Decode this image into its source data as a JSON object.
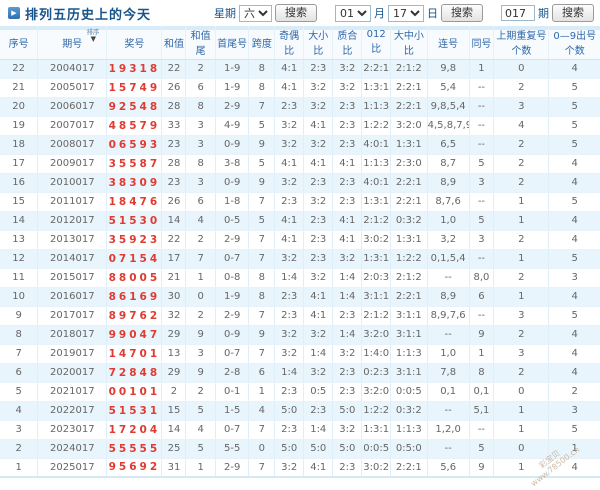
{
  "title": "排列五历史上的今天",
  "toolbar": {
    "week_label": "星期",
    "week_value": "六",
    "search_label": "搜索",
    "month_value": "01",
    "month_label": "月",
    "day_value": "17",
    "day_label": "日",
    "issue_value": "017",
    "issue_label": "期"
  },
  "table": {
    "sort_label": "排序",
    "sort_arrow": "▼",
    "columns": [
      "序号",
      "期号",
      "奖号",
      "和值",
      "和值尾",
      "首尾号",
      "跨度",
      "奇偶比",
      "大小比",
      "质合比",
      "012比",
      "大中小比",
      "连号",
      "同号",
      "上期重复号个数",
      "0—9出号个数"
    ],
    "rows": [
      [
        "22",
        "2004017",
        "19318",
        "22",
        "2",
        "1-9",
        "8",
        "4:1",
        "2:3",
        "3:2",
        "2:2:1",
        "2:1:2",
        "9,8",
        "1",
        "0",
        "4"
      ],
      [
        "21",
        "2005017",
        "15749",
        "26",
        "6",
        "1-9",
        "8",
        "4:1",
        "3:2",
        "3:2",
        "1:3:1",
        "2:2:1",
        "5,4",
        "--",
        "2",
        "5"
      ],
      [
        "20",
        "2006017",
        "92548",
        "28",
        "8",
        "2-9",
        "7",
        "2:3",
        "3:2",
        "2:3",
        "1:1:3",
        "2:2:1",
        "9,8,5,4",
        "--",
        "3",
        "5"
      ],
      [
        "19",
        "2007017",
        "48579",
        "33",
        "3",
        "4-9",
        "5",
        "3:2",
        "4:1",
        "2:3",
        "1:2:2",
        "3:2:0",
        "4,5,8,7,9",
        "--",
        "4",
        "5"
      ],
      [
        "18",
        "2008017",
        "06593",
        "23",
        "3",
        "0-9",
        "9",
        "3:2",
        "3:2",
        "2:3",
        "4:0:1",
        "1:3:1",
        "6,5",
        "--",
        "2",
        "5"
      ],
      [
        "17",
        "2009017",
        "35587",
        "28",
        "8",
        "3-8",
        "5",
        "4:1",
        "4:1",
        "4:1",
        "1:1:3",
        "2:3:0",
        "8,7",
        "5",
        "2",
        "4"
      ],
      [
        "16",
        "2010017",
        "38309",
        "23",
        "3",
        "0-9",
        "9",
        "3:2",
        "2:3",
        "2:3",
        "4:0:1",
        "2:2:1",
        "8,9",
        "3",
        "2",
        "4"
      ],
      [
        "15",
        "2011017",
        "18476",
        "26",
        "6",
        "1-8",
        "7",
        "2:3",
        "3:2",
        "2:3",
        "1:3:1",
        "2:2:1",
        "8,7,6",
        "--",
        "1",
        "5"
      ],
      [
        "14",
        "2012017",
        "51530",
        "14",
        "4",
        "0-5",
        "5",
        "4:1",
        "2:3",
        "4:1",
        "2:1:2",
        "0:3:2",
        "1,0",
        "5",
        "1",
        "4"
      ],
      [
        "13",
        "2013017",
        "35923",
        "22",
        "2",
        "2-9",
        "7",
        "4:1",
        "2:3",
        "4:1",
        "3:0:2",
        "1:3:1",
        "3,2",
        "3",
        "2",
        "4"
      ],
      [
        "12",
        "2014017",
        "07154",
        "17",
        "7",
        "0-7",
        "7",
        "3:2",
        "2:3",
        "3:2",
        "1:3:1",
        "1:2:2",
        "0,1,5,4",
        "--",
        "1",
        "5"
      ],
      [
        "11",
        "2015017",
        "88005",
        "21",
        "1",
        "0-8",
        "8",
        "1:4",
        "3:2",
        "1:4",
        "2:0:3",
        "2:1:2",
        "--",
        "8,0",
        "2",
        "3"
      ],
      [
        "10",
        "2016017",
        "86169",
        "30",
        "0",
        "1-9",
        "8",
        "2:3",
        "4:1",
        "1:4",
        "3:1:1",
        "2:2:1",
        "8,9",
        "6",
        "1",
        "4"
      ],
      [
        "9",
        "2017017",
        "89762",
        "32",
        "2",
        "2-9",
        "7",
        "2:3",
        "4:1",
        "2:3",
        "2:1:2",
        "3:1:1",
        "8,9,7,6",
        "--",
        "3",
        "5"
      ],
      [
        "8",
        "2018017",
        "99047",
        "29",
        "9",
        "0-9",
        "9",
        "3:2",
        "3:2",
        "1:4",
        "3:2:0",
        "3:1:1",
        "--",
        "9",
        "2",
        "4"
      ],
      [
        "7",
        "2019017",
        "14701",
        "13",
        "3",
        "0-7",
        "7",
        "3:2",
        "1:4",
        "3:2",
        "1:4:0",
        "1:1:3",
        "1,0",
        "1",
        "3",
        "4"
      ],
      [
        "6",
        "2020017",
        "72848",
        "29",
        "9",
        "2-8",
        "6",
        "1:4",
        "3:2",
        "2:3",
        "0:2:3",
        "3:1:1",
        "7,8",
        "8",
        "2",
        "4"
      ],
      [
        "5",
        "2021017",
        "00101",
        "2",
        "2",
        "0-1",
        "1",
        "2:3",
        "0:5",
        "2:3",
        "3:2:0",
        "0:0:5",
        "0,1",
        "0,1",
        "0",
        "2"
      ],
      [
        "4",
        "2022017",
        "51531",
        "15",
        "5",
        "1-5",
        "4",
        "5:0",
        "2:3",
        "5:0",
        "1:2:2",
        "0:3:2",
        "--",
        "5,1",
        "1",
        "3"
      ],
      [
        "3",
        "2023017",
        "17204",
        "14",
        "4",
        "0-7",
        "7",
        "2:3",
        "1:4",
        "3:2",
        "1:3:1",
        "1:1:3",
        "1,2,0",
        "--",
        "1",
        "5"
      ],
      [
        "2",
        "2024017",
        "55555",
        "25",
        "5",
        "5-5",
        "0",
        "5:0",
        "5:0",
        "5:0",
        "0:0:5",
        "0:5:0",
        "--",
        "5",
        "0",
        "1"
      ],
      [
        "1",
        "2025017",
        "95692",
        "31",
        "1",
        "2-9",
        "7",
        "3:2",
        "4:1",
        "2:3",
        "3:0:2",
        "2:2:1",
        "5,6",
        "9",
        "1",
        "4"
      ]
    ]
  },
  "watermark": {
    "line1": "彩宝贝",
    "line2": "www.78500.cn"
  },
  "colors": {
    "accent_blue": "#17548a",
    "header_text": "#2f67a8",
    "prize_red": "#e03b32",
    "stripe": "#e9f5fc"
  }
}
